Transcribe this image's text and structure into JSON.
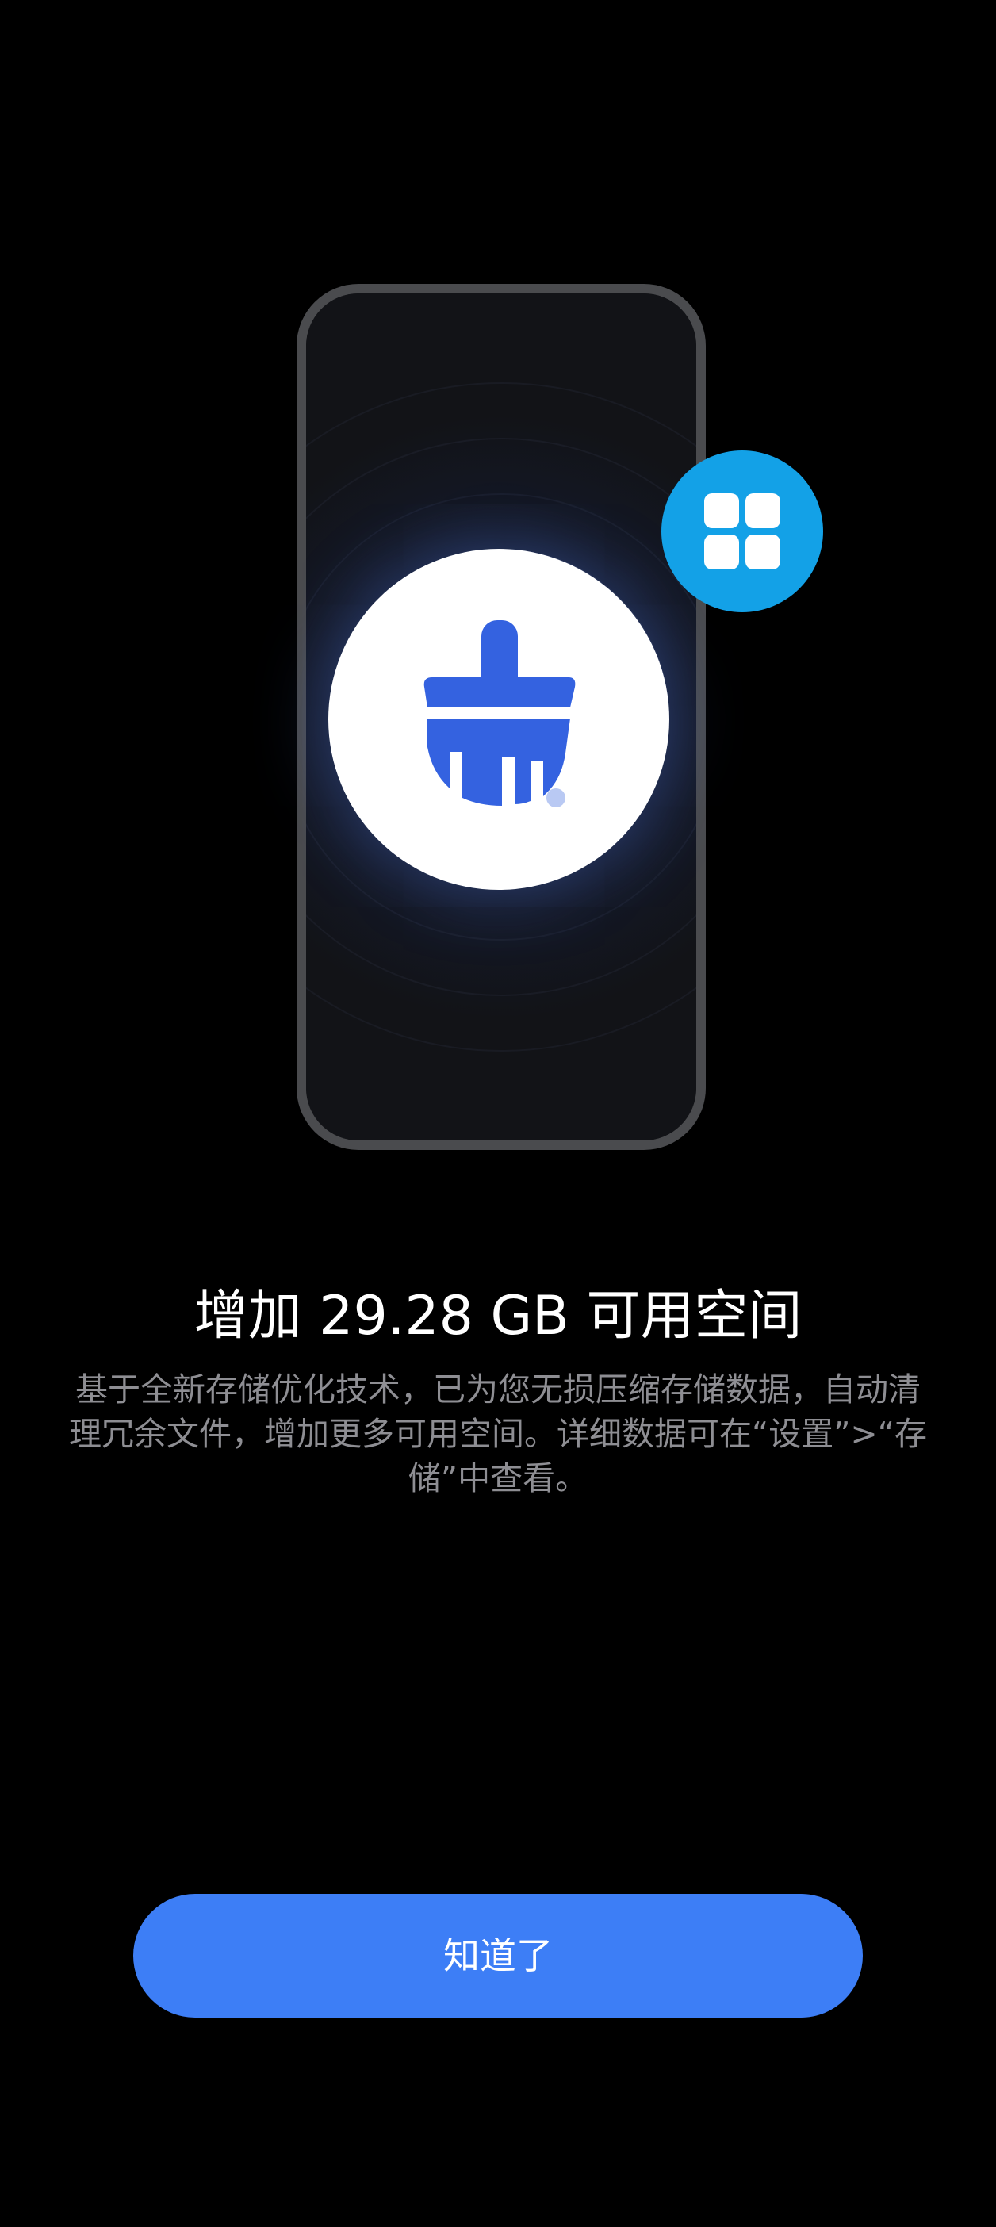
{
  "illustration": {
    "main_icon": "broom-clean-icon",
    "badge_icon": "apps-grid-icon",
    "colors": {
      "broom": "#3462e0",
      "badge": "#13a1e7",
      "phone_frame": "#4a4b4e"
    }
  },
  "result": {
    "title": "增加 29.28 GB 可用空间",
    "description": "基于全新存储优化技术，已为您无损压缩存储数据，自动清理冗余文件，增加更多可用空间。详细数据可在“设置”>“存储”中查看。"
  },
  "actions": {
    "confirm_label": "知道了",
    "accent_color": "#3d7ef6"
  }
}
